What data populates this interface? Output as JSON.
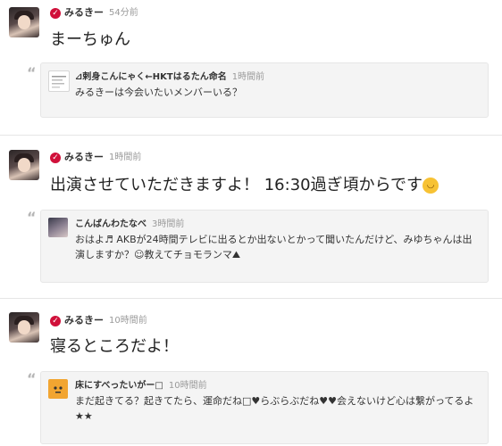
{
  "posts": [
    {
      "author": "みるきー",
      "time": "54分前",
      "text": "まーちゅん",
      "reply": {
        "author": "⊿剌身こんにゃく←HKTはるたん命名",
        "time": "1時間前",
        "text": "みるきーは今会いたいメンバーいる？"
      }
    },
    {
      "author": "みるきー",
      "time": "1時間前",
      "text": "出演させていただきますよ！ 16:30過ぎ頃からです",
      "emoji_icon": "smiling-face-emoji",
      "reply": {
        "author": "こんばんわたなべ",
        "time": "3時間前",
        "text": "おはよ♬ AKBが24時間テレビに出るとか出ないとかって聞いたんだけど、みゆちゃんは出演しますか？☺教えてチョモランマ⛰"
      }
    },
    {
      "author": "みるきー",
      "time": "10時間前",
      "text": "寝るところだよ！",
      "reply": {
        "author": "床にすべったいがー□",
        "time": "10時間前",
        "text": "まだ起きてる？起きてたら、運命だね□♥らぶらぶだね♥♥会えないけど心は繋がってるよ★★"
      }
    }
  ],
  "colors": {
    "verified_badge": "#d0103a",
    "reply_background": "#f4f4f4",
    "timestamp": "#9a9a9a"
  },
  "icons": {
    "verified": "verified-check-icon",
    "quote": "quote-icon"
  }
}
